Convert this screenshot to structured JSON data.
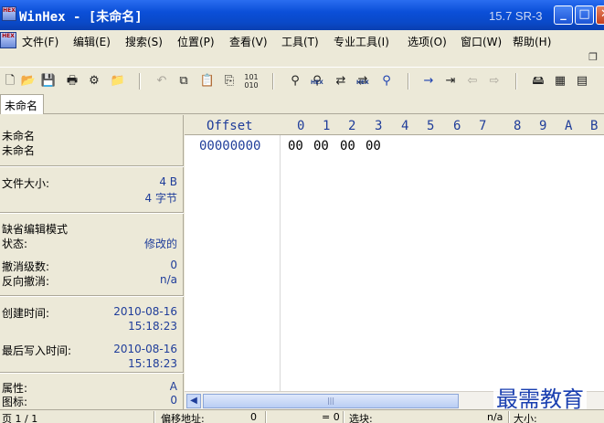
{
  "window": {
    "app_icon": "HEX",
    "title": "WinHex - [未命名]",
    "version": "15.7 SR-3",
    "minimize": "_",
    "maximize": "□",
    "close": "✕"
  },
  "menu": {
    "items": [
      {
        "label": "文件(F)"
      },
      {
        "label": "编辑(E)"
      },
      {
        "label": "搜索(S)"
      },
      {
        "label": "位置(P)"
      },
      {
        "label": "查看(V)"
      },
      {
        "label": "工具(T)"
      },
      {
        "label": "专业工具(I)"
      },
      {
        "label": "选项(O)"
      },
      {
        "label": "窗口(W)"
      },
      {
        "label": "帮助(H)"
      }
    ],
    "mdi_restore": "❐"
  },
  "toolbar": {
    "icons": [
      "new-file-icon",
      "open-icon",
      "save-icon",
      "print-icon",
      "properties-icon",
      "open-folder-icon",
      "undo-icon",
      "copy-icon",
      "paste-icon",
      "paste-special-icon",
      "binary-icon",
      "find-icon",
      "find-hex-icon",
      "replace-icon",
      "replace-hex-icon",
      "find-next-icon",
      "goto-offset-icon",
      "goto-icon",
      "back-icon",
      "forward-icon",
      "disk-icon",
      "ram-icon",
      "calculator-icon"
    ]
  },
  "tab": {
    "label": "未命名"
  },
  "info": {
    "name_line1": "未命名",
    "name_line2": "未命名",
    "size_label": "文件大小:",
    "size_bytes": "4 B",
    "size_chars": "4 字节",
    "mode_label": "缺省编辑模式",
    "state_label": "状态:",
    "state_value": "修改的",
    "undo_level_label": "撤消级数:",
    "undo_level_value": "0",
    "reverse_undo_label": "反向撤消:",
    "reverse_undo_value": "n/a",
    "created_label": "创建时间:",
    "created_date": "2010-08-16",
    "created_time": "15:18:23",
    "written_label": "最后写入时间:",
    "written_date": "2010-08-16",
    "written_time": "15:18:23",
    "attr_label": "属性:",
    "attr_value": "A",
    "icon_label": "图标:",
    "icon_value": "0"
  },
  "hex": {
    "offset_header": "Offset",
    "columns": [
      "0",
      "1",
      "2",
      "3",
      "4",
      "5",
      "6",
      "7",
      "8",
      "9",
      "A",
      "B"
    ],
    "row_offset": "00000000",
    "row_bytes": [
      "00",
      "00",
      "00",
      "00"
    ]
  },
  "scrollbar": {
    "left_arrow": "◀",
    "thumb_grip": "|||"
  },
  "watermark": "最需教育",
  "status": {
    "page": "页 1 / 1",
    "offset_label": "偏移地址:",
    "offset_value": "0",
    "equals": "= 0",
    "block_label": "选块:",
    "block_value": "n/a",
    "size_label": "大小:"
  }
}
